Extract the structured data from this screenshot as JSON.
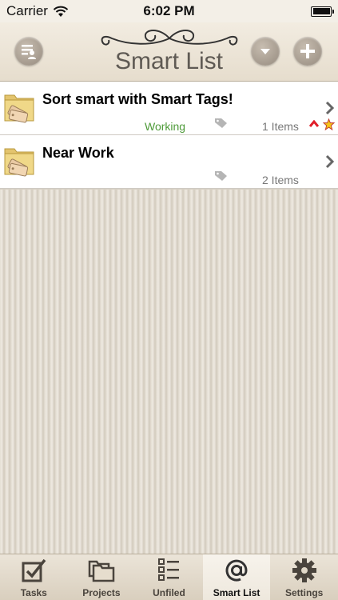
{
  "status_bar": {
    "carrier": "Carrier",
    "time": "6:02 PM"
  },
  "header": {
    "title": "Smart List"
  },
  "rows": [
    {
      "title": "Sort smart with Smart Tags!",
      "context": "Working",
      "count": "1 Items",
      "priority": "high",
      "starred": true
    },
    {
      "title": "Near Work",
      "context": "",
      "count": "2 Items",
      "priority": "none",
      "starred": false
    }
  ],
  "tabs": [
    {
      "label": "Tasks",
      "icon": "checkbox-icon"
    },
    {
      "label": "Projects",
      "icon": "folders-icon"
    },
    {
      "label": "Unfiled",
      "icon": "list-icon"
    },
    {
      "label": "Smart List",
      "icon": "at-icon",
      "active": true
    },
    {
      "label": "Settings",
      "icon": "gear-icon"
    }
  ],
  "colors": {
    "context_green": "#4d9a38",
    "priority_red": "#e0202a",
    "star_yellow": "#f5c518"
  }
}
